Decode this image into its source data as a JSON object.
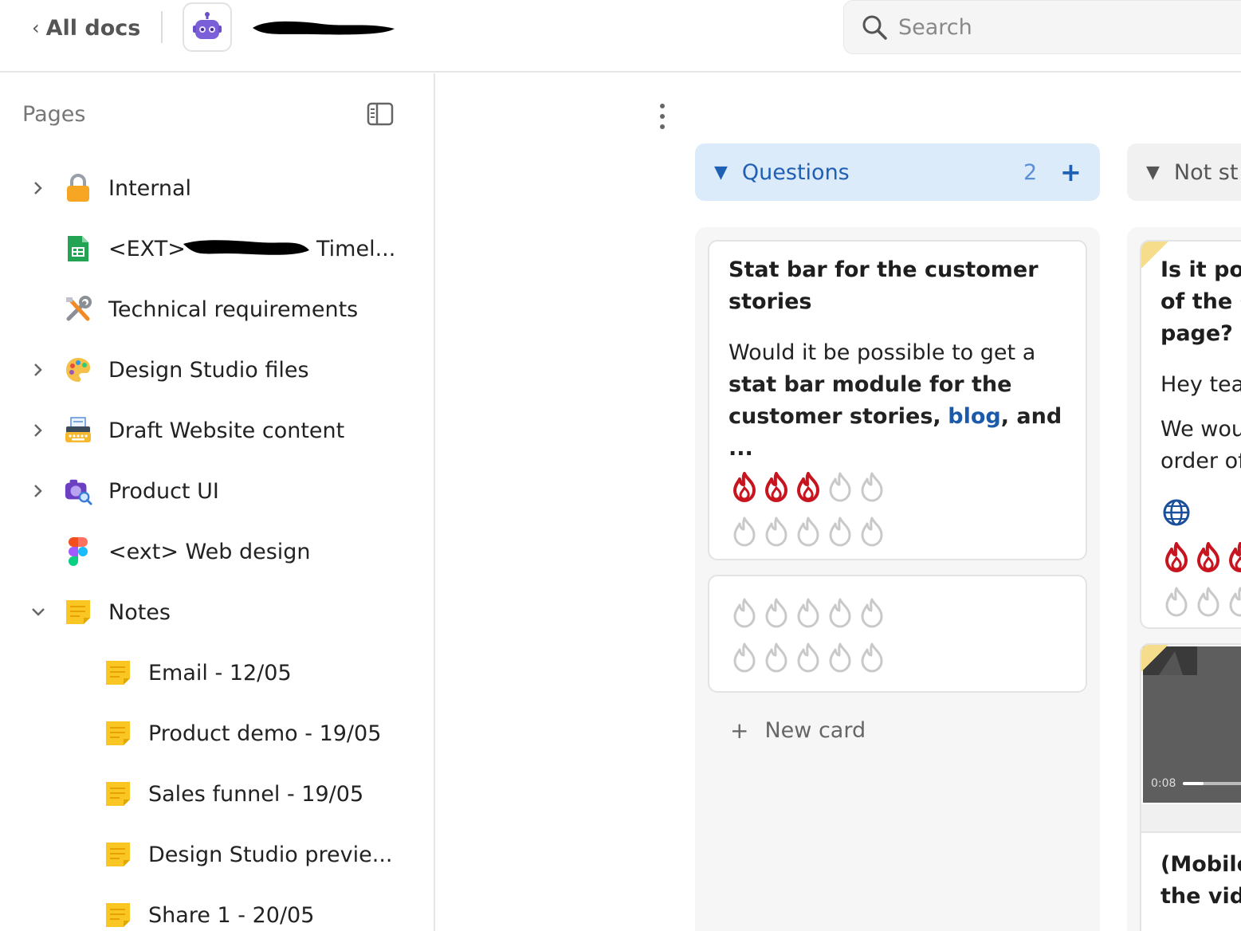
{
  "topbar": {
    "back_label": "All docs",
    "doc_icon": "robot-icon",
    "search_placeholder": "Search"
  },
  "sidebar": {
    "title": "Pages",
    "items": [
      {
        "label": "Internal",
        "icon": "lock-icon",
        "chevron": "right",
        "level": 0
      },
      {
        "label": "<EXT>",
        "label_suffix": "Timel...",
        "icon": "spreadsheet-icon",
        "chevron": "none",
        "level": 0
      },
      {
        "label": "Technical requirements",
        "icon": "tools-icon",
        "chevron": "none",
        "level": 0
      },
      {
        "label": "Design Studio files",
        "icon": "palette-icon",
        "chevron": "right",
        "level": 0
      },
      {
        "label": "Draft Website content",
        "icon": "typewriter-icon",
        "chevron": "right",
        "level": 0
      },
      {
        "label": "Product UI",
        "icon": "camera-icon",
        "chevron": "right",
        "level": 0
      },
      {
        "label": "<ext> Web design",
        "icon": "figma-icon",
        "chevron": "none",
        "level": 0
      },
      {
        "label": "Notes",
        "icon": "note-icon",
        "chevron": "down",
        "level": 0
      },
      {
        "label": "Email - 12/05",
        "icon": "note-icon",
        "chevron": "none",
        "level": 1
      },
      {
        "label": "Product demo - 19/05",
        "icon": "note-icon",
        "chevron": "none",
        "level": 1
      },
      {
        "label": "Sales funnel - 19/05",
        "icon": "note-icon",
        "chevron": "none",
        "level": 1
      },
      {
        "label": "Design Studio previe...",
        "icon": "note-icon",
        "chevron": "none",
        "level": 1
      },
      {
        "label": "Share 1 - 20/05",
        "icon": "note-icon",
        "chevron": "none",
        "level": 1
      }
    ]
  },
  "board": {
    "columns": [
      {
        "name": "Questions",
        "count": "2",
        "accent": "#1f5fb4",
        "header_bg": "#dcebf9",
        "cards": [
          {
            "title": "Stat bar for the customer stories",
            "body_1": "Would it be possible to get a",
            "body_bold_1": "stat bar module for the",
            "body_bold_2": "customer stories,",
            "body_link": "blog",
            "body_tail": ", and ...",
            "rating_filled": 3,
            "rating_total": 5
          },
          {
            "title": "",
            "rating_filled": 0,
            "rating_total": 5
          }
        ],
        "new_card_label": "New card"
      },
      {
        "name": "Not st",
        "accent": "#666666",
        "header_bg": "#f1f1f1",
        "cards": [
          {
            "title_l1": "Is it pos",
            "title_l2": "of the C",
            "title_l3": "page?",
            "body_l1": "Hey tea",
            "body_l2": "We wou",
            "body_l3": "order of",
            "icon": "globe-icon",
            "rating_filled": 3
          },
          {
            "video_time": "0:08",
            "title_l1": "(Mobile)",
            "title_l2": "the vide"
          }
        ]
      }
    ]
  }
}
